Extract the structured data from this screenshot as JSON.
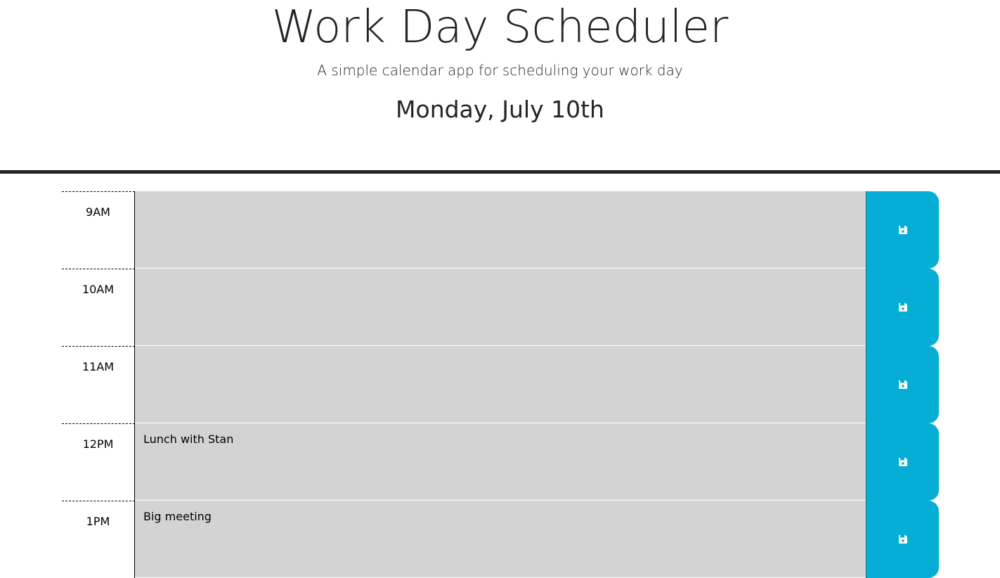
{
  "header": {
    "title": "Work Day Scheduler",
    "subtitle": "A simple calendar app for scheduling your work day",
    "current_day": "Monday, July 10th"
  },
  "colors": {
    "past": "#d3d3d3",
    "save_button": "#06aed5",
    "text": "#212529"
  },
  "time_blocks": [
    {
      "hour": "9AM",
      "description": "",
      "status": "past"
    },
    {
      "hour": "10AM",
      "description": "",
      "status": "past"
    },
    {
      "hour": "11AM",
      "description": "",
      "status": "past"
    },
    {
      "hour": "12PM",
      "description": "Lunch with Stan",
      "status": "past"
    },
    {
      "hour": "1PM",
      "description": "Big meeting",
      "status": "past"
    }
  ],
  "icons": {
    "save": "floppy-disk-icon"
  }
}
